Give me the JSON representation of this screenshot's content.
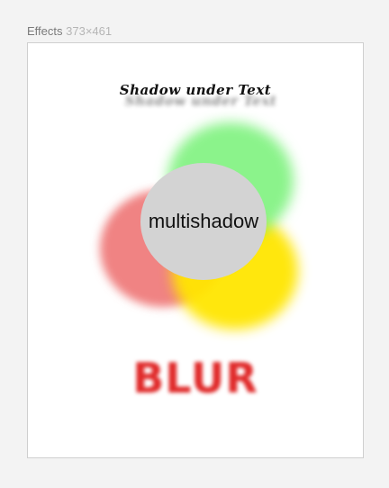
{
  "header": {
    "title": "Effects",
    "dimensions": "373×461"
  },
  "canvas": {
    "shadow_text": "Shadow under Text",
    "multishadow_label": "multishadow",
    "blur_text": "BLUR"
  },
  "colors": {
    "green": "#6ef06e",
    "yellow": "#ffe600",
    "red": "#eb5a5a",
    "circle": "#d3d3d3",
    "blur": "#e02a2a"
  }
}
